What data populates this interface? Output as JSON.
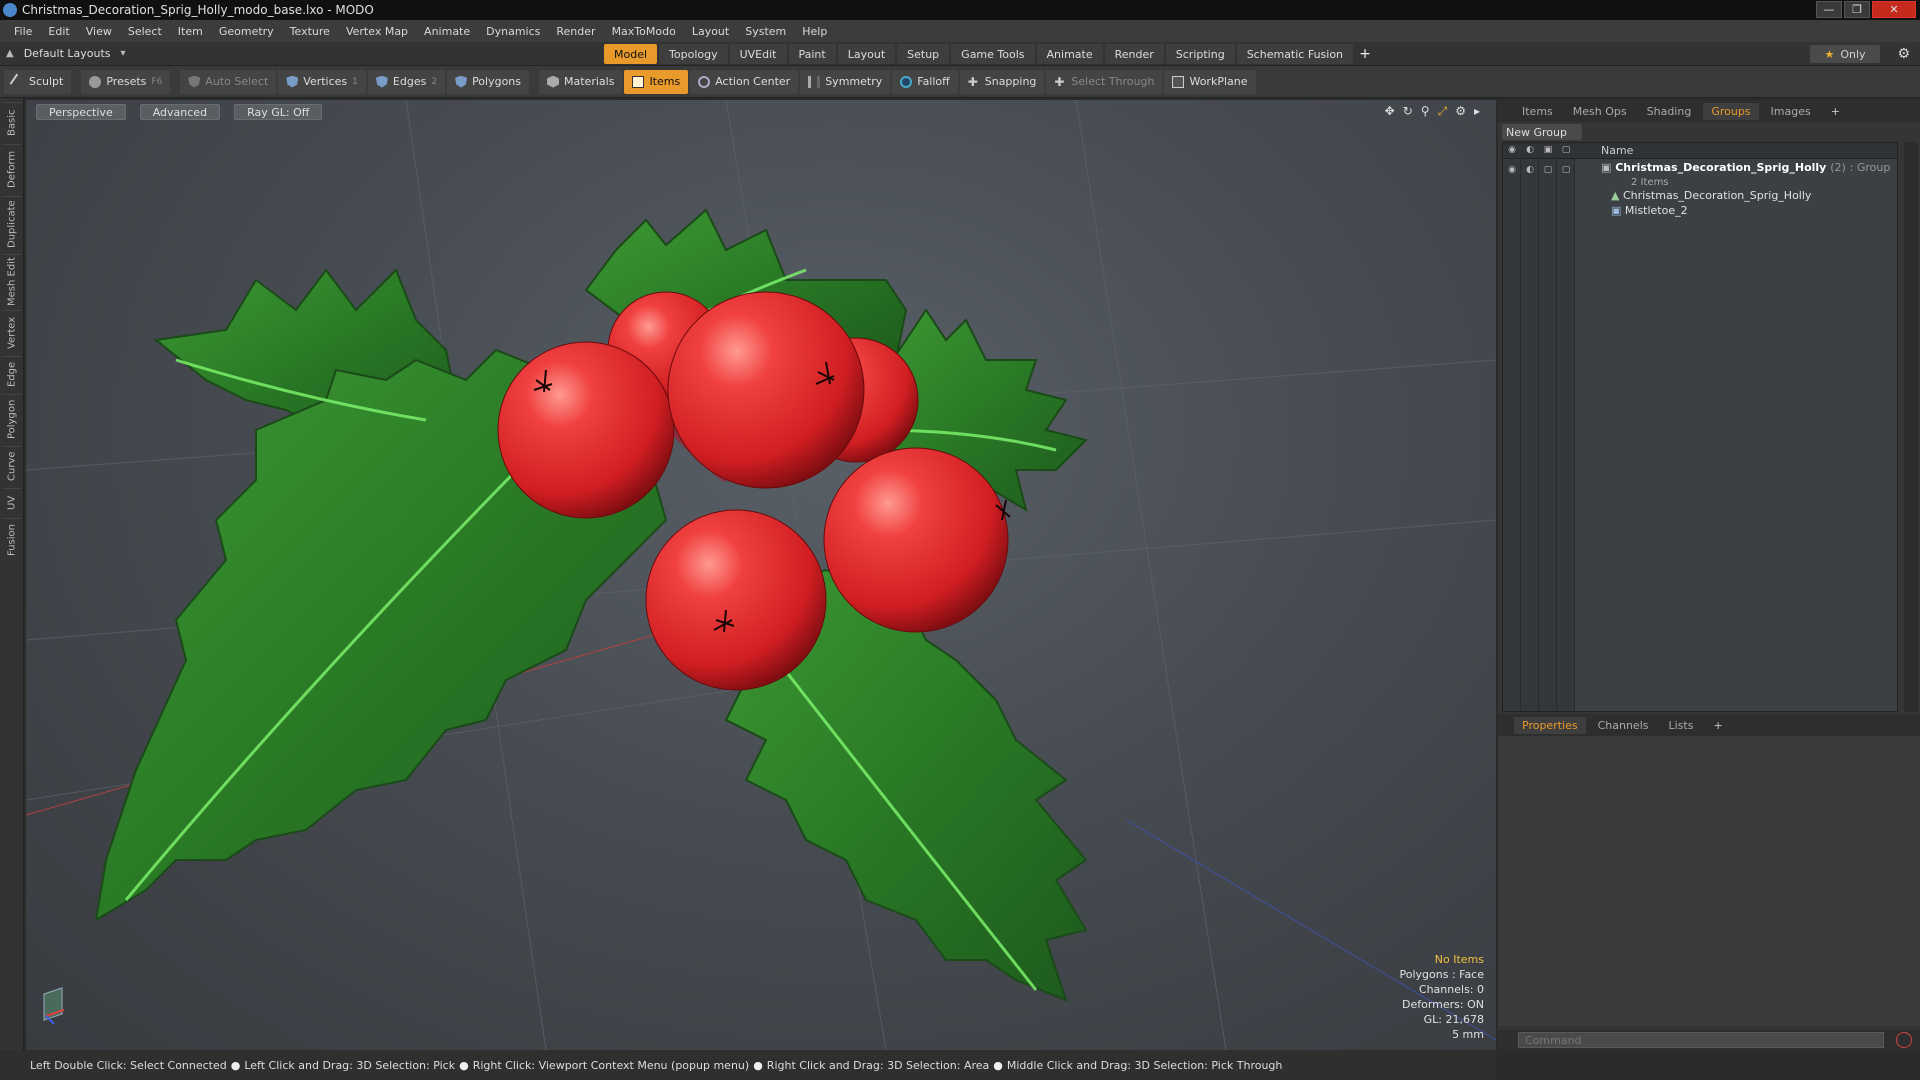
{
  "window": {
    "title": "Christmas_Decoration_Sprig_Holly_modo_base.lxo - MODO"
  },
  "menu": [
    "File",
    "Edit",
    "View",
    "Select",
    "Item",
    "Geometry",
    "Texture",
    "Vertex Map",
    "Animate",
    "Dynamics",
    "Render",
    "MaxToModo",
    "Layout",
    "System",
    "Help"
  ],
  "layout": {
    "selector": "Default Layouts",
    "only": "Only"
  },
  "tabs": [
    "Model",
    "Topology",
    "UVEdit",
    "Paint",
    "Layout",
    "Setup",
    "Game Tools",
    "Animate",
    "Render",
    "Scripting",
    "Schematic Fusion"
  ],
  "tabs_active": "Model",
  "toolbar": {
    "sculpt": "Sculpt",
    "presets": "Presets",
    "presets_key": "F6",
    "auto_select": "Auto Select",
    "vertices": "Vertices",
    "vertices_key": "1",
    "edges": "Edges",
    "edges_key": "2",
    "polygons": "Polygons",
    "materials": "Materials",
    "items": "Items",
    "action_center": "Action Center",
    "symmetry": "Symmetry",
    "falloff": "Falloff",
    "snapping": "Snapping",
    "select_through": "Select Through",
    "workplane": "WorkPlane"
  },
  "left_tabs": [
    "Basic",
    "Deform",
    "Duplicate",
    "Mesh Edit",
    "Vertex",
    "Edge",
    "Polygon",
    "Curve",
    "UV",
    "Fusion"
  ],
  "viewport": {
    "perspective": "Perspective",
    "advanced": "Advanced",
    "raygl": "Ray GL: Off",
    "stats": {
      "items": "No Items",
      "polygons": "Polygons : Face",
      "channels": "Channels: 0",
      "deformers": "Deformers: ON",
      "gl": "GL: 21,678",
      "unit": "5 mm"
    }
  },
  "right_panel": {
    "tabs": [
      "Items",
      "Mesh Ops",
      "Shading",
      "Groups",
      "Images"
    ],
    "active_tab": "Groups",
    "new_group": "New Group",
    "name_header": "Name",
    "group": {
      "name": "Christmas_Decoration_Sprig_Holly",
      "count": "(2)",
      "type": ": Group",
      "sub": "2 Items"
    },
    "children": [
      "Christmas_Decoration_Sprig_Holly",
      "Mistletoe_2"
    ]
  },
  "properties": {
    "tabs": [
      "Properties",
      "Channels",
      "Lists"
    ],
    "active_tab": "Properties",
    "command_placeholder": "Command"
  },
  "status": [
    "Left Double Click: Select Connected",
    "Left Click and Drag: 3D Selection: Pick",
    "Right Click: Viewport Context Menu (popup menu)",
    "Right Click and Drag: 3D Selection: Area",
    "Middle Click and Drag: 3D Selection: Pick Through"
  ],
  "colors": {
    "accent": "#e89a2a",
    "berry": "#e0262a",
    "leaf": "#2f8a2a"
  }
}
